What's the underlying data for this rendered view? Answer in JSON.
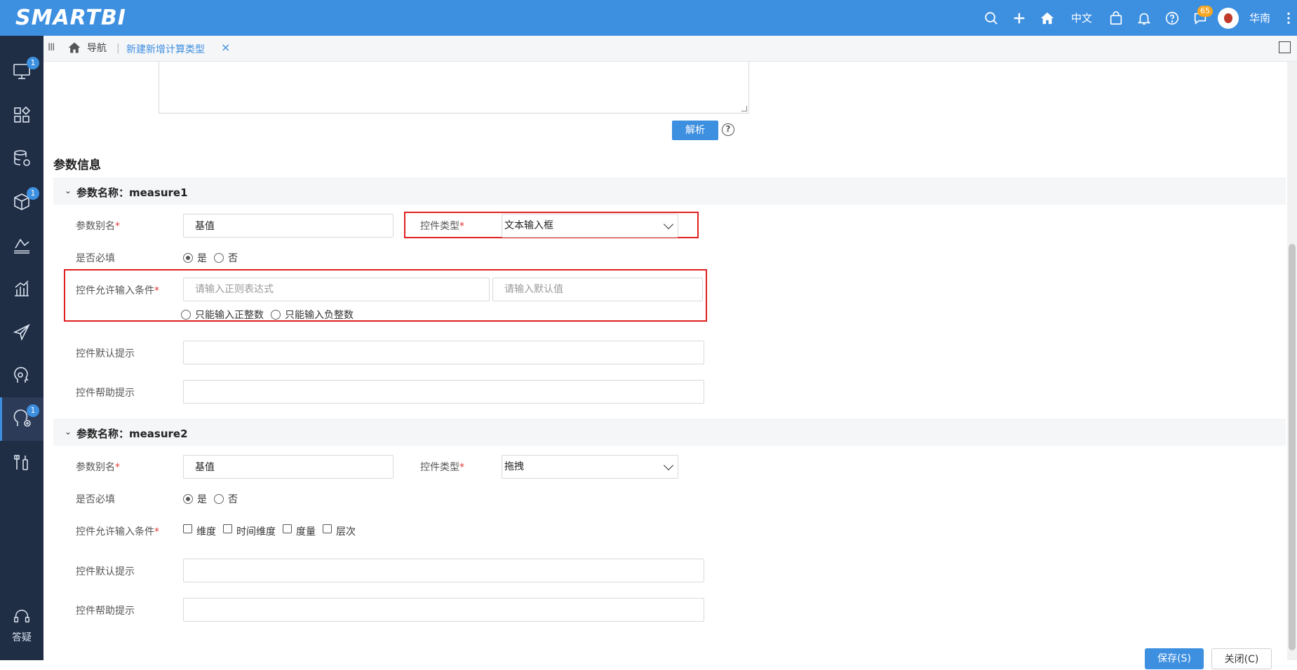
{
  "app": {
    "logo": "SMARTBI"
  },
  "topbar": {
    "icons": [
      "search-icon",
      "plus-icon",
      "home-icon",
      "bag-icon",
      "bell-icon",
      "help-icon",
      "chat-icon"
    ],
    "language": "中文",
    "chat_badge": "65",
    "user_name": "华南"
  },
  "sidebar": {
    "items": [
      {
        "icon": "monitor-icon",
        "badge": "1"
      },
      {
        "icon": "widgets-icon",
        "badge": ""
      },
      {
        "icon": "database-gear-icon",
        "badge": ""
      },
      {
        "icon": "cube-icon",
        "badge": "1"
      },
      {
        "icon": "analysis-icon",
        "badge": ""
      },
      {
        "icon": "bar-chart-icon",
        "badge": ""
      },
      {
        "icon": "send-icon",
        "badge": ""
      },
      {
        "icon": "ai-head-icon",
        "badge": ""
      },
      {
        "icon": "ai-settings-icon",
        "badge": "1"
      },
      {
        "icon": "tools-icon",
        "badge": ""
      }
    ],
    "bottom_label": "答疑",
    "colors": {
      "bg": "#1f2d45",
      "accent": "#3d8fe0"
    }
  },
  "tabs": {
    "menu_glyph": "III",
    "home_label": "导航",
    "separator": "|",
    "active_label": "新建新增计算类型",
    "close_glyph": "×"
  },
  "expression": {
    "parse_label": "解析",
    "help_glyph": "?"
  },
  "params": {
    "section_title": "参数信息",
    "groups": [
      {
        "header": "参数名称：measure1",
        "alias_label": "参数别名",
        "alias_value": "基值",
        "control_type_label": "控件类型",
        "control_type_value": "文本输入框",
        "required_label": "是否必填",
        "yes_label": "是",
        "no_label": "否",
        "condition_label": "控件允许输入条件",
        "regex_placeholder": "请输入正则表达式",
        "default_placeholder": "请输入默认值",
        "pos_int_label": "只能输入正整数",
        "neg_int_label": "只能输入负整数",
        "default_hint_label": "控件默认提示",
        "help_hint_label": "控件帮助提示"
      },
      {
        "header": "参数名称：measure2",
        "alias_label": "参数别名",
        "alias_value": "基值",
        "control_type_label": "控件类型",
        "control_type_value": "拖拽",
        "required_label": "是否必填",
        "yes_label": "是",
        "no_label": "否",
        "condition_label": "控件允许输入条件",
        "checks": [
          "维度",
          "时间维度",
          "度量",
          "层次"
        ],
        "default_hint_label": "控件默认提示",
        "help_hint_label": "控件帮助提示"
      }
    ],
    "required_mark": "*",
    "highlight_color": "#e02020"
  },
  "footer": {
    "save_label": "保存(S)",
    "close_label": "关闭(C)"
  }
}
